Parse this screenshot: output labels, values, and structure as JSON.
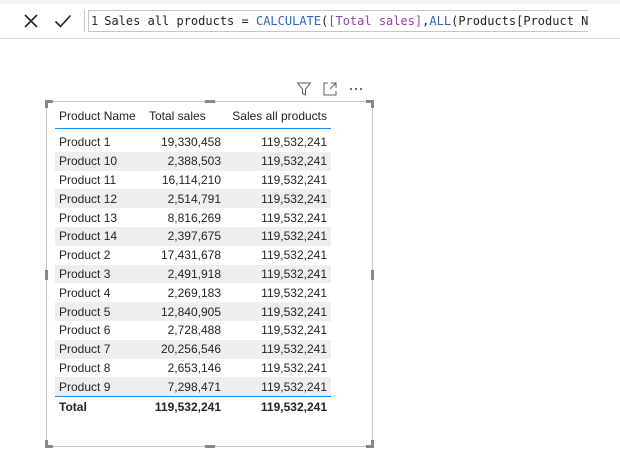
{
  "formula_bar": {
    "line_number": "1",
    "measure_name": "Sales all products",
    "equals": "=",
    "calc_fn": "CALCULATE",
    "open_paren_1": "(",
    "measure_ref": "[Total sales]",
    "comma": ",",
    "all_fn": "ALL",
    "open_paren_2": "(",
    "column_ref": "Products[Product Name]",
    "close_parens": "))",
    "cancel_icon": "close-icon",
    "commit_icon": "checkmark-icon"
  },
  "visual_header": {
    "filter_icon": "filter-icon",
    "focus_icon": "focus-mode-icon",
    "more_icon": "more-options-icon"
  },
  "table": {
    "headers": [
      "Product Name",
      "Total sales",
      "Sales all products"
    ],
    "rows": [
      [
        "Product 1",
        "19,330,458",
        "119,532,241"
      ],
      [
        "Product 10",
        "2,388,503",
        "119,532,241"
      ],
      [
        "Product 11",
        "16,114,210",
        "119,532,241"
      ],
      [
        "Product 12",
        "2,514,791",
        "119,532,241"
      ],
      [
        "Product 13",
        "8,816,269",
        "119,532,241"
      ],
      [
        "Product 14",
        "2,397,675",
        "119,532,241"
      ],
      [
        "Product 2",
        "17,431,678",
        "119,532,241"
      ],
      [
        "Product 3",
        "2,491,918",
        "119,532,241"
      ],
      [
        "Product 4",
        "2,269,183",
        "119,532,241"
      ],
      [
        "Product 5",
        "12,840,905",
        "119,532,241"
      ],
      [
        "Product 6",
        "2,728,488",
        "119,532,241"
      ],
      [
        "Product 7",
        "20,256,546",
        "119,532,241"
      ],
      [
        "Product 8",
        "2,653,146",
        "119,532,241"
      ],
      [
        "Product 9",
        "7,298,471",
        "119,532,241"
      ]
    ],
    "total": [
      "Total",
      "119,532,241",
      "119,532,241"
    ]
  },
  "colors": {
    "accent_blue": "#118dff",
    "dax_function": "#3165bb",
    "dax_reference": "#8e44ad",
    "row_band": "#eeeeee"
  }
}
